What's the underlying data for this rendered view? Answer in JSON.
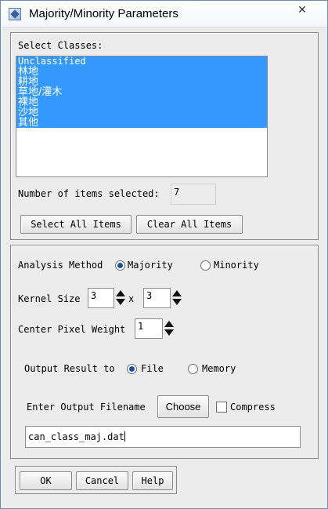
{
  "window": {
    "title": "Majority/Minority Parameters",
    "close_glyph": "✕"
  },
  "classes": {
    "label": "Select Classes:",
    "items": [
      "Unclassified",
      "林地",
      "耕地",
      "草地/灌木",
      "裸地",
      "沙地",
      "其他"
    ],
    "count_label": "Number of items selected:",
    "count_value": "7",
    "select_all_label": "Select All Items",
    "clear_all_label": "Clear All Items"
  },
  "analysis": {
    "method_label": "Analysis Method",
    "majority_label": "Majority",
    "minority_label": "Minority",
    "selected_method": "Majority",
    "kernel_label": "Kernel Size",
    "kernel_x": "3",
    "kernel_sep": "x",
    "kernel_y": "3",
    "weight_label": "Center Pixel Weight",
    "weight_value": "1",
    "output_label": "Output Result to",
    "file_label": "File",
    "memory_label": "Memory",
    "selected_output": "File",
    "filename_label": "Enter Output Filename",
    "choose_label": "Choose",
    "compress_label": "Compress",
    "compress_checked": false,
    "filename_value": "can_class_maj.dat"
  },
  "footer": {
    "ok_label": "OK",
    "cancel_label": "Cancel",
    "help_label": "Help"
  },
  "colors": {
    "selection": "#3399ff",
    "background": "#ececec"
  }
}
